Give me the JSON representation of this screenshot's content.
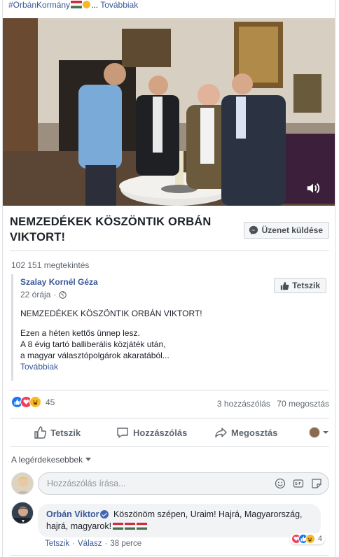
{
  "header": {
    "hashtag": "#OrbánKormány",
    "ellipsis": "...",
    "more_link": "Továbbiak"
  },
  "video": {
    "title": "NEMZEDÉKEK KÖSZÖNTIK ORBÁN VIKTORT!",
    "volume_icon": "speaker-muted-icon"
  },
  "message_button": "Üzenet küldése",
  "views": "102 151 megtekintés",
  "shared_post": {
    "author": "Szalay Kornél Géza",
    "time": "22 órája",
    "privacy_icon": "globe-icon",
    "like_page_button": "Tetszik",
    "heading": "NEMZEDÉKEK KÖSZÖNTIK ORBÁN VIKTORT!",
    "line1": "Ezen a héten kettős ünnep lesz.",
    "line2": "A 8 évig tartó balliberális közjáték után,",
    "line3": "a magyar választópolgárok akaratából...",
    "more": "Továbbiak"
  },
  "reactions": {
    "count": "45",
    "comments": "3 hozzászólás",
    "shares": "70 megosztás"
  },
  "actions": {
    "like": "Tetszik",
    "comment": "Hozzászólás",
    "share": "Megosztás"
  },
  "sort": {
    "label": "A legérdekesebbek"
  },
  "composer": {
    "placeholder": "Hozzászólás írása..."
  },
  "comment": {
    "author": "Orbán Viktor",
    "text": "Köszönöm szépen, Uraim! Hajrá, Magyarország, hajrá, magyarok!",
    "like": "Tetszik",
    "reply": "Válasz",
    "time": "38 perce",
    "reaction_count": "4"
  },
  "colors": {
    "link": "#385898",
    "like_blue": "#1877f2",
    "love_red": "#f33e58",
    "haha_yellow": "#f7b928",
    "muted": "#606770"
  }
}
